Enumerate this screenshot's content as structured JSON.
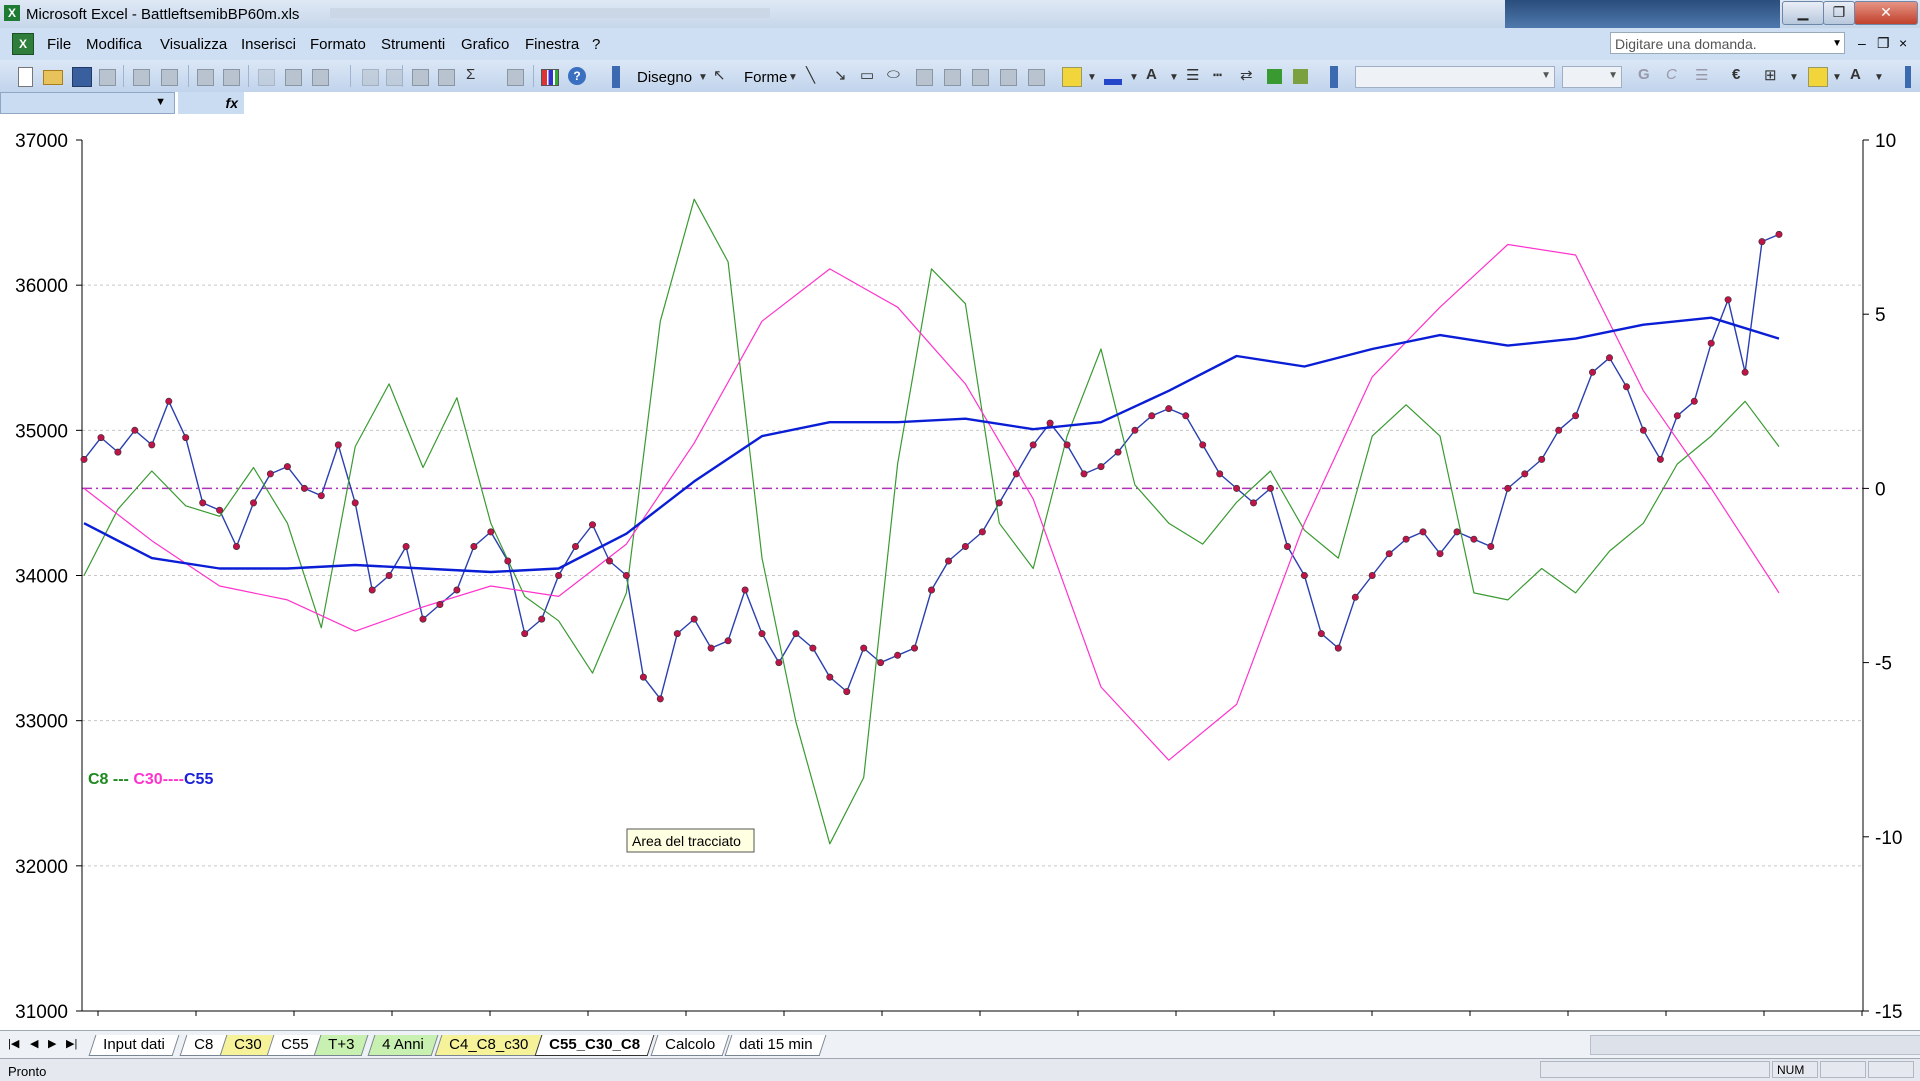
{
  "window": {
    "title": "Microsoft Excel - BattleftsemibBP60m.xls",
    "buttons": {
      "minimize": "▁",
      "restore": "❐",
      "close": "✕"
    }
  },
  "menu": {
    "items": [
      "File",
      "Modifica",
      "Visualizza",
      "Inserisci",
      "Formato",
      "Strumenti",
      "Grafico",
      "Finestra",
      "?"
    ],
    "ask_placeholder": "Digitare una domanda.",
    "mdi": {
      "minimize": "–",
      "restore": "❐",
      "close": "×"
    }
  },
  "toolbar": {
    "draw_label": "Disegno",
    "shapes_label": "Forme",
    "bold": "G",
    "italic": "C",
    "currency": "€",
    "sum": "Σ",
    "fx": "fx"
  },
  "sheets": {
    "tabs": [
      {
        "label": "Input dati",
        "style": "plain"
      },
      {
        "label": "C8",
        "style": "plain"
      },
      {
        "label": "C30",
        "style": "yellow"
      },
      {
        "label": "C55",
        "style": "plain"
      },
      {
        "label": "T+3",
        "style": "green"
      },
      {
        "label": "4 Anni",
        "style": "green"
      },
      {
        "label": "C4_C8_c30",
        "style": "yellow"
      },
      {
        "label": "C55_C30_C8",
        "style": "active"
      },
      {
        "label": "Calcolo",
        "style": "plain"
      },
      {
        "label": "dati 15 min",
        "style": "plain"
      }
    ],
    "nav": [
      "|◀",
      "◀",
      "▶",
      "▶|"
    ]
  },
  "status": {
    "text": "Pronto",
    "num": "NUM"
  },
  "chart_data": {
    "type": "line",
    "legend_text": {
      "c8": "C8",
      "sep1": " --- ",
      "c30": "C30",
      "sep2": "----",
      "c55": "C55"
    },
    "tooltip": "Area del tracciato",
    "left_axis": {
      "ylim": [
        31000,
        37000
      ],
      "ticks": [
        "37000",
        "36000",
        "35000",
        "34000",
        "33000",
        "32000",
        "31000"
      ]
    },
    "right_axis": {
      "ylim": [
        -15,
        10
      ],
      "ticks": [
        "10",
        "5",
        "0",
        "-5",
        "-10",
        "-15"
      ]
    },
    "zero_line": 0,
    "grid": true,
    "colors": {
      "price": "#2b3fb0",
      "marker": "#c0134a",
      "c8": "#3a9a32",
      "c30": "#ff33cc",
      "c55": "#0a1ed6",
      "zero": "#b030b8"
    },
    "series": [
      {
        "key": "price",
        "axis": "left",
        "x": [
          0,
          1,
          2,
          3,
          4,
          5,
          6,
          7,
          8,
          9,
          10,
          11,
          12,
          13,
          14,
          15,
          16,
          17,
          18,
          19,
          20,
          21,
          22,
          23,
          24,
          25,
          26,
          27,
          28,
          29,
          30,
          31,
          32,
          33,
          34,
          35,
          36,
          37,
          38,
          39,
          40,
          41,
          42,
          43,
          44,
          45,
          46,
          47,
          48,
          49,
          50,
          51,
          52,
          53,
          54,
          55,
          56,
          57,
          58,
          59,
          60,
          61,
          62,
          63,
          64,
          65,
          66,
          67,
          68,
          69,
          70,
          71,
          72,
          73,
          74,
          75,
          76,
          77,
          78,
          79,
          80,
          81,
          82,
          83,
          84,
          85,
          86,
          87,
          88,
          89,
          90,
          91,
          92,
          93,
          94,
          95,
          96,
          97,
          98,
          99,
          100
        ],
        "y": [
          34800,
          34950,
          34850,
          35000,
          34900,
          35200,
          34950,
          34500,
          34450,
          34200,
          34500,
          34700,
          34750,
          34600,
          34550,
          34900,
          34500,
          33900,
          34000,
          34200,
          33700,
          33800,
          33900,
          34200,
          34300,
          34100,
          33600,
          33700,
          34000,
          34200,
          34350,
          34100,
          34000,
          33300,
          33150,
          33600,
          33700,
          33500,
          33550,
          33900,
          33600,
          33400,
          33600,
          33500,
          33300,
          33200,
          33500,
          33400,
          33450,
          33500,
          33900,
          34100,
          34200,
          34300,
          34500,
          34700,
          34900,
          35050,
          34900,
          34700,
          34750,
          34850,
          35000,
          35100,
          35150,
          35100,
          34900,
          34700,
          34600,
          34500,
          34600,
          34200,
          34000,
          33600,
          33500,
          33850,
          34000,
          34150,
          34250,
          34300,
          34150,
          34300,
          34250,
          34200,
          34600,
          34700,
          34800,
          35000,
          35100,
          35400,
          35500,
          35300,
          35000,
          34800,
          35100,
          35200,
          35600,
          35900,
          35400,
          36300,
          36350
        ]
      },
      {
        "key": "c8",
        "axis": "right",
        "x": [
          0,
          2,
          4,
          6,
          8,
          10,
          12,
          14,
          16,
          18,
          20,
          22,
          24,
          26,
          28,
          30,
          32,
          34,
          36,
          38,
          40,
          42,
          44,
          46,
          48,
          50,
          52,
          54,
          56,
          58,
          60,
          62,
          64,
          66,
          68,
          70,
          72,
          74,
          76,
          78,
          80,
          82,
          84,
          86,
          88,
          90,
          92,
          94,
          96,
          98,
          100
        ],
        "y": [
          -2.5,
          -0.6,
          0.5,
          -0.5,
          -0.8,
          0.6,
          -1,
          -4,
          1.2,
          3,
          0.6,
          2.6,
          -1,
          -3.1,
          -3.8,
          -5.3,
          -3,
          4.8,
          8.3,
          6.5,
          -2,
          -6.7,
          -10.2,
          -8.3,
          0.7,
          6.3,
          5.3,
          -1,
          -2.3,
          1.5,
          4,
          0.1,
          -1,
          -1.6,
          -0.4,
          0.5,
          -1.2,
          -2,
          1.5,
          2.4,
          1.5,
          -3,
          -3.2,
          -2.3,
          -3,
          -1.8,
          -1,
          0.7,
          1.5,
          2.5,
          1.2
        ]
      },
      {
        "key": "c30",
        "axis": "right",
        "x": [
          0,
          4,
          8,
          12,
          16,
          20,
          24,
          28,
          32,
          36,
          40,
          44,
          48,
          52,
          56,
          60,
          64,
          68,
          72,
          76,
          80,
          84,
          88,
          92,
          96,
          100
        ],
        "y": [
          0,
          -1.5,
          -2.8,
          -3.2,
          -4.1,
          -3.4,
          -2.8,
          -3.1,
          -1.6,
          1.3,
          4.8,
          6.3,
          5.2,
          3,
          -0.3,
          -5.7,
          -7.8,
          -6.2,
          -1,
          3.2,
          5.2,
          7,
          6.7,
          2.8,
          0,
          -3
        ]
      },
      {
        "key": "c55",
        "axis": "right",
        "x": [
          0,
          4,
          8,
          12,
          16,
          20,
          24,
          28,
          32,
          36,
          40,
          44,
          48,
          52,
          56,
          60,
          64,
          68,
          72,
          76,
          80,
          84,
          88,
          92,
          96,
          100
        ],
        "y": [
          -1,
          -2,
          -2.3,
          -2.3,
          -2.2,
          -2.3,
          -2.4,
          -2.3,
          -1.3,
          0.2,
          1.5,
          1.9,
          1.9,
          2,
          1.7,
          1.9,
          2.8,
          3.8,
          3.5,
          4,
          4.4,
          4.1,
          4.3,
          4.7,
          4.9,
          4.3
        ]
      }
    ]
  }
}
